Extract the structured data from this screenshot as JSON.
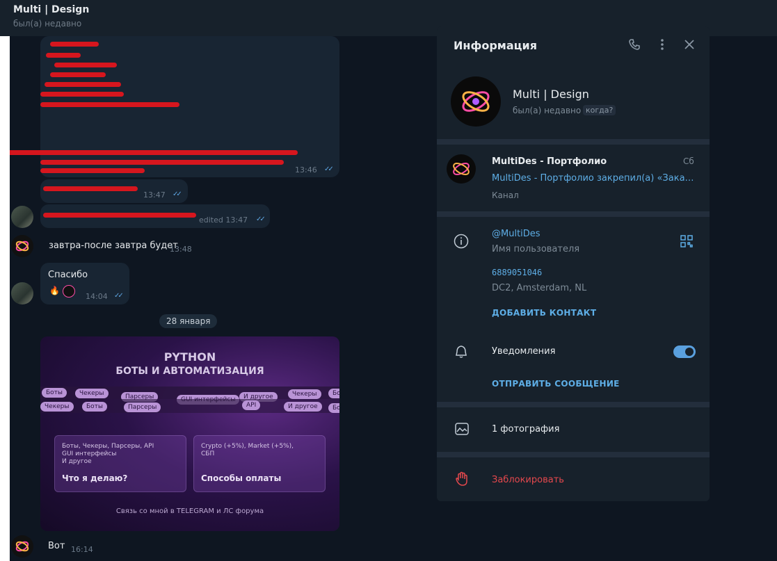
{
  "header": {
    "title": "Multi | Design",
    "status": "был(а) недавно"
  },
  "messages": [
    {
      "time": "13:46"
    },
    {
      "time": "13:47"
    },
    {
      "time": "edited 13:47"
    },
    {
      "text": "завтра-после завтра будет",
      "time": "13:48"
    },
    {
      "text": "Спасибо",
      "time": "14:04",
      "reaction": "🔥"
    },
    {
      "text": "Вот",
      "time": "16:14"
    }
  ],
  "date_separator": "28 января",
  "promo": {
    "title1": "PYTHON",
    "title2": "БОТЫ И АВТОМАТИЗАЦИЯ",
    "pills_row1": [
      "Боты",
      "Чекеры",
      "Парсеры",
      "GUI интерфейсы",
      "И другое",
      "Чекеры",
      "Бо"
    ],
    "pills_row2": [
      "Чекеры",
      "Боты",
      "Парсеры",
      "API",
      "И другое",
      "Бо"
    ],
    "card1_small": "Боты, Чекеры, Парсеры, API\nGUI интерфейсы\nИ другое",
    "card1_big": "Что я делаю?",
    "card2_small": "Crypto (+5%), Market (+5%),\nСБП",
    "card2_big": "Способы оплаты",
    "footer": "Связь со мной в TELEGRAM и ЛС форума"
  },
  "panel": {
    "title": "Информация",
    "name": "Multi | Design",
    "status": "был(а) недавно",
    "when_badge": "когда?",
    "channel": {
      "name": "MultiDes - Портфолио",
      "day": "Сб",
      "pinned": "MultiDes - Портфолио закрепил(а) «Заказать ...",
      "type": "Канал"
    },
    "username": "@MultiDes",
    "username_label": "Имя пользователя",
    "phone": "6889051046",
    "dc": "DC2, Amsterdam, NL",
    "add_contact": "ДОБАВИТЬ КОНТАКТ",
    "notifications": "Уведомления",
    "notifications_on": true,
    "send_message": "ОТПРАВИТЬ СООБЩЕНИЕ",
    "photos": "1 фотография",
    "block": "Заблокировать"
  },
  "colors": {
    "accent": "#5eaee6",
    "danger": "#e5484d",
    "panel_bg": "#17212b",
    "chat_bg": "#0e1621"
  }
}
